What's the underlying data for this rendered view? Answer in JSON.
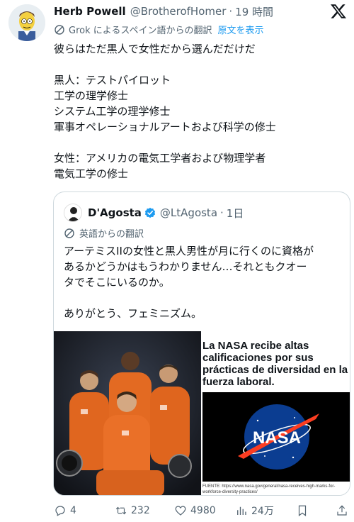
{
  "post": {
    "author_name": "Herb Powell",
    "author_handle": "@BrotherofHomer",
    "separator": "·",
    "time": "19 時間",
    "translation_note": "Grok によるスペイン語からの翻訳",
    "show_original": "原文を表示",
    "text_lines": [
      "彼らはただ黒人で女性だから選んだだけだ",
      "",
      "黒人：テストパイロット",
      "工学の理学修士",
      "システム工学の理学修士",
      "軍事オペレーショナルアートおよび科学の修士",
      "",
      "女性：アメリカの電気工学者および物理学者",
      "電気工学の修士"
    ]
  },
  "quote": {
    "author_name": "D'Agosta",
    "author_handle": "@LtAgosta",
    "separator": "·",
    "time": "1日",
    "translation_note": "英語からの翻訳",
    "text_lines": [
      "アーテミスIIの女性と黒人男性が月に行くのに資格が",
      "あるかどうかはもうわかりません…それともクオー",
      "タでそこにいるのか。",
      "",
      "ありがとう、フェミニズム。"
    ],
    "article": {
      "title_lines": [
        "La NASA recibe altas",
        "calificaciones por sus",
        "prácticas de diversidad en la",
        "fuerza laboral."
      ],
      "logo_text": "NASA",
      "source": "FUENTE: https://www.nasa.gov/general/nasa-receives-high-marks-for-workforce-diversity-practices/"
    }
  },
  "actions": {
    "replies": "4",
    "reposts": "232",
    "likes": "4980",
    "views": "24万"
  },
  "colors": {
    "link": "#1d9bf0",
    "muted": "#536471",
    "verified": "#1d9bf0",
    "nasa_blue": "#0b3d91",
    "nasa_red": "#fc3d21"
  }
}
